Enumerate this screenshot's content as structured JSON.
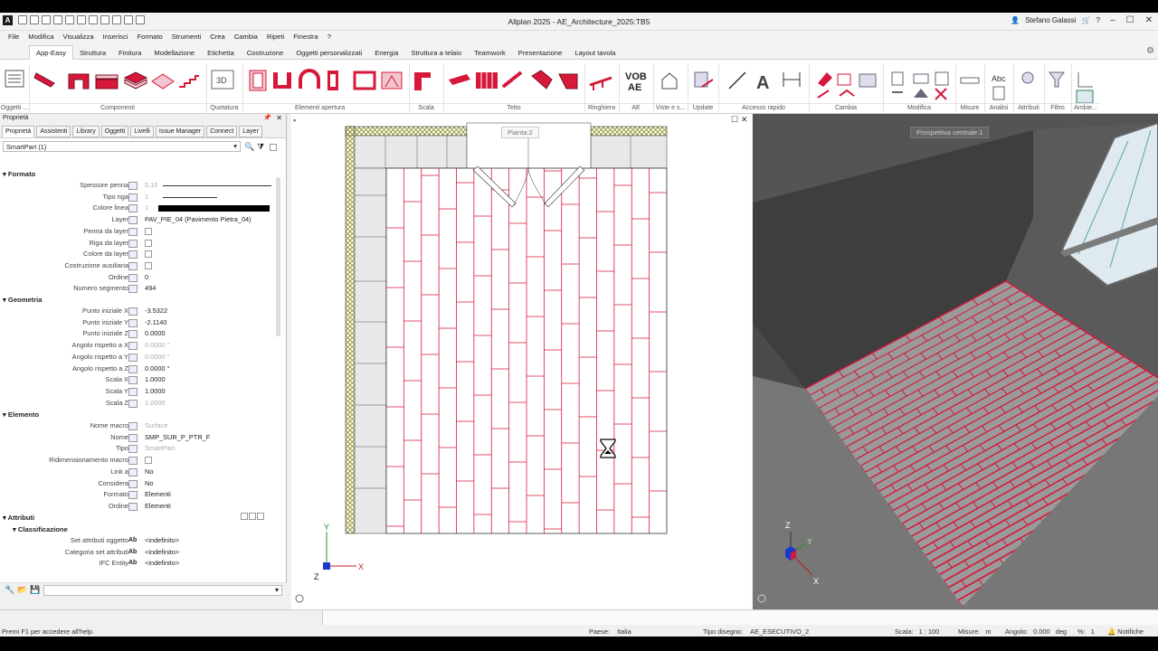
{
  "app": {
    "title": "Allplan 2025 - AE_Architecture_2025:TB5",
    "user": "Stefano Galassi",
    "logo_letter": "A"
  },
  "menu": [
    "File",
    "Modifica",
    "Visualizza",
    "Inserisci",
    "Formato",
    "Strumenti",
    "Crea",
    "Cambia",
    "Ripeti",
    "Finestra",
    "?"
  ],
  "ribbon_tabs": [
    {
      "label": "App-Easy",
      "active": true
    },
    {
      "label": "Struttura"
    },
    {
      "label": "Finitura"
    },
    {
      "label": "Modellazione"
    },
    {
      "label": "Etichetta"
    },
    {
      "label": "Costruzione"
    },
    {
      "label": "Oggetti personalizzati"
    },
    {
      "label": "Energia"
    },
    {
      "label": "Struttura a telaio"
    },
    {
      "label": "Teamwork"
    },
    {
      "label": "Presentazione"
    },
    {
      "label": "Layout tavola"
    }
  ],
  "ribbon_groups": [
    "Oggetti ...",
    "Componenti",
    "Quotatura",
    "Elementi apertura",
    "Scala",
    "Tetto",
    "Ringhiera",
    "AE",
    "Viste e s...",
    "Update",
    "Accesso rapido",
    "Cambia",
    "Modifica",
    "Misure",
    "Analisi",
    "Attributi",
    "Filtro",
    "Ambie..."
  ],
  "ribbon_texts": {
    "vob": "VOB",
    "ae": "AE",
    "abc": "Abc",
    "label_3d": "3D",
    "label_a": "A"
  },
  "panel": {
    "title": "Proprietà",
    "tabs": [
      "Proprietà",
      "Assistenti",
      "Library",
      "Oggetti",
      "Livelli",
      "Issue Manager",
      "Connect",
      "Layer"
    ],
    "selection": "SmartPart (1)",
    "sections": {
      "formato": "Formato",
      "geometria": "Geometria",
      "elemento": "Elemento",
      "attributi": "Attributi",
      "classificazione": "Classificazione"
    },
    "formato_rows": [
      {
        "label": "Spessore penna",
        "value": "0.10",
        "dim": true
      },
      {
        "label": "Tipo riga",
        "value": "1",
        "dim": true
      },
      {
        "label": "Colore linea",
        "value": "1",
        "dim": true
      },
      {
        "label": "Layer",
        "value": "PAV_PIE_04 (Pavimento Pietra_04)"
      },
      {
        "label": "Penna da layer",
        "value": ""
      },
      {
        "label": "Riga da layer",
        "value": ""
      },
      {
        "label": "Colore da layer",
        "value": ""
      },
      {
        "label": "Costruzione ausiliaria",
        "value": ""
      },
      {
        "label": "Ordine",
        "value": "0"
      },
      {
        "label": "Numero segmento",
        "value": "494"
      }
    ],
    "geometria_rows": [
      {
        "label": "Punto iniziale X",
        "value": "-3.5322"
      },
      {
        "label": "Punto iniziale Y",
        "value": "-2.1140"
      },
      {
        "label": "Punto iniziale Z",
        "value": "0.0000"
      },
      {
        "label": "Angolo rispetto a X",
        "value": "0.0000 °",
        "dim": true
      },
      {
        "label": "Angolo rispetto a Y",
        "value": "0.0000 °",
        "dim": true
      },
      {
        "label": "Angolo rispetto a Z",
        "value": "0.0000 °"
      },
      {
        "label": "Scala X",
        "value": "1.0000"
      },
      {
        "label": "Scala Y",
        "value": "1.0000"
      },
      {
        "label": "Scala Z",
        "value": "1.0000",
        "dim": true
      }
    ],
    "elemento_rows": [
      {
        "label": "Nome macro",
        "value": "Surface",
        "dim": true
      },
      {
        "label": "Nome",
        "value": "SMP_SUR_P_PTR_F"
      },
      {
        "label": "Tipo",
        "value": "SmartPart",
        "dim": true
      },
      {
        "label": "Ridimensionamento macro",
        "value": ""
      },
      {
        "label": "Link a",
        "value": "No"
      },
      {
        "label": "Considera",
        "value": "No"
      },
      {
        "label": "Formato",
        "value": "Elementi"
      },
      {
        "label": "Ordine",
        "value": "Elementi"
      }
    ],
    "classificazione_rows": [
      {
        "label": "Set attributi oggetto",
        "value": "<indefinito>"
      },
      {
        "label": "Categoria set attributi",
        "value": "<indefinito>"
      },
      {
        "label": "IFC Entity",
        "value": "<indefinito>"
      }
    ],
    "ab_label": "Ab"
  },
  "viewport_left": {
    "label": "Pianta:2",
    "axis_x": "X",
    "axis_y": "Y",
    "axis_z": "Z"
  },
  "viewport_right": {
    "label": "Prospettiva centrale:1",
    "axis_x": "X",
    "axis_y": "Y",
    "axis_z": "Z"
  },
  "status": {
    "help": "Premi F1 per accedere all'help.",
    "paese_label": "Paese:",
    "paese_value": "Italia",
    "tipo_label": "Tipo disegno:",
    "tipo_value": "AE_ESECUTIVO_2",
    "scala_label": "Scala:",
    "scala_value": "1 : 100",
    "misure_label": "Misure:",
    "misure_value": "m",
    "angolo_label": "Angolo:",
    "angolo_value": "0.000",
    "angolo_unit": "deg",
    "pct_label": "%:",
    "pct_value": "1",
    "notifiche": "Notifiche"
  },
  "colors": {
    "accent": "#d6193a",
    "wall_hatch": "#c8c24a",
    "floor_3d": "#9a9a9a"
  }
}
